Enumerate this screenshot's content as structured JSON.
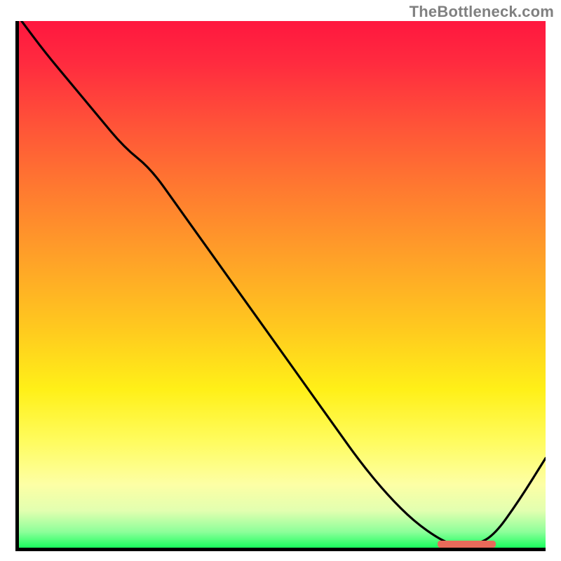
{
  "watermark": "TheBottleneck.com",
  "chart_data": {
    "type": "line",
    "title": "",
    "xlabel": "",
    "ylabel": "",
    "xlim": [
      0,
      100
    ],
    "ylim": [
      0,
      100
    ],
    "grid": false,
    "legend": false,
    "background": "red-to-green vertical gradient",
    "series": [
      {
        "name": "curve",
        "x": [
          0.5,
          5,
          10,
          15,
          20,
          25,
          30,
          35,
          40,
          45,
          50,
          55,
          60,
          65,
          70,
          75,
          80,
          83,
          86,
          90,
          95,
          100
        ],
        "values": [
          100,
          94,
          88,
          82,
          76,
          72,
          65,
          58,
          51,
          44,
          37,
          30,
          23,
          16,
          10,
          5,
          1.5,
          0.4,
          0.4,
          2,
          9,
          17
        ],
        "color": "#000000"
      }
    ],
    "marker": {
      "x_start": 79,
      "x_end": 90,
      "y": 0.5,
      "color": "#e86a5a"
    }
  }
}
